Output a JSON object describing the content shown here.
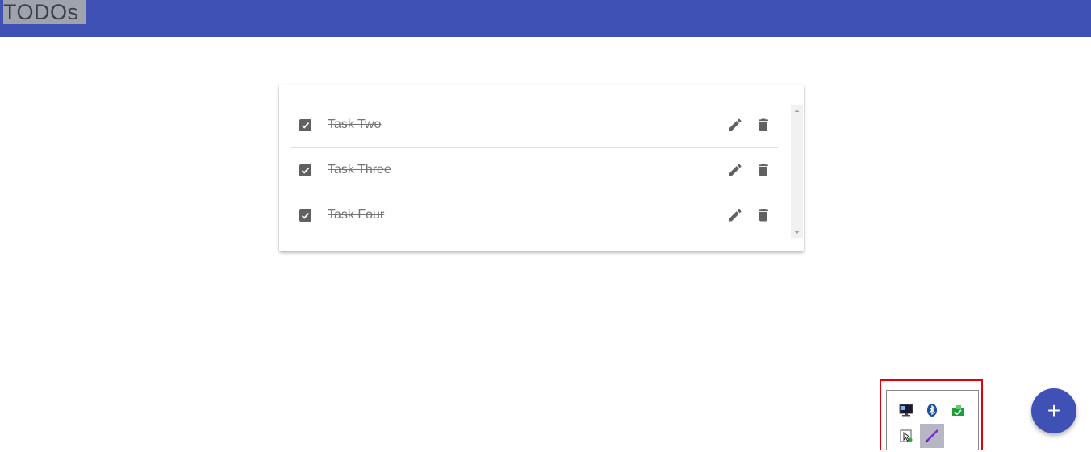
{
  "app_bar": {
    "title": "TODOs",
    "color": "#3f51b5"
  },
  "todos": [
    {
      "label": "Task Two",
      "completed": true
    },
    {
      "label": "Task Three",
      "completed": true
    },
    {
      "label": "Task Four",
      "completed": true
    }
  ],
  "row_actions": {
    "edit_icon": "pencil-icon",
    "delete_icon": "trash-icon"
  },
  "fab": {
    "label": "+",
    "color": "#3f51b5"
  },
  "system_tray": {
    "highlight_color": "#e0000f",
    "icons": [
      "display-settings-icon",
      "bluetooth-icon",
      "network-share-icon",
      "pointer-tool-icon",
      "pen-tool-icon"
    ]
  }
}
